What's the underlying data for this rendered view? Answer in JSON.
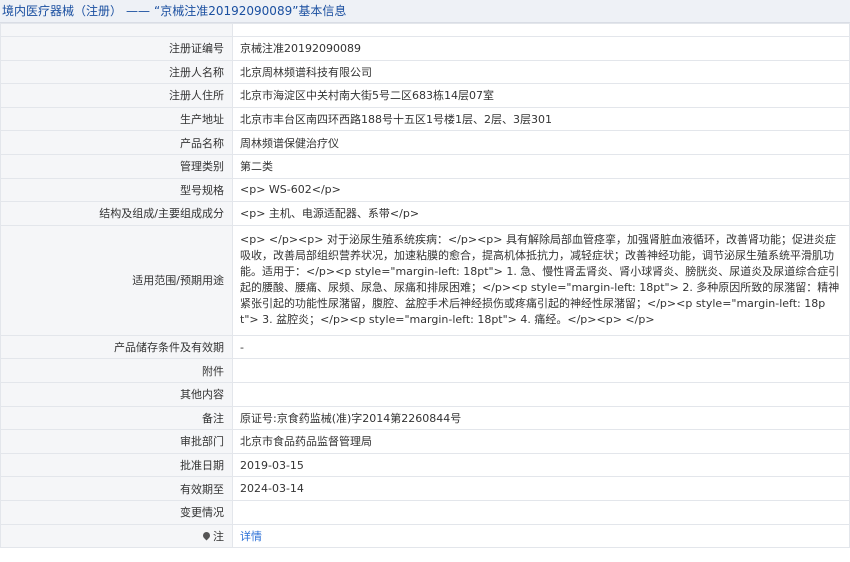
{
  "header": {
    "category": "境内医疗器械（注册）",
    "separator": "——",
    "title": "“京械注准20192090089”基本信息"
  },
  "rows": [
    {
      "label": "注册证编号",
      "value": "京械注准20192090089"
    },
    {
      "label": "注册人名称",
      "value": "北京周林频谱科技有限公司"
    },
    {
      "label": "注册人住所",
      "value": "北京市海淀区中关村南大街5号二区683栋14层07室"
    },
    {
      "label": "生产地址",
      "value": "北京市丰台区南四环西路188号十五区1号楼1层、2层、3层301"
    },
    {
      "label": "产品名称",
      "value": "周林频谱保健治疗仪"
    },
    {
      "label": "管理类别",
      "value": "第二类"
    },
    {
      "label": "型号规格",
      "value": "<p> WS-602</p>"
    },
    {
      "label": "结构及组成/主要组成成分",
      "value": "<p> 主机、电源适配器、系带</p>"
    },
    {
      "label": "适用范围/预期用途",
      "value": "<p> </p><p> 对于泌尿生殖系统疾病：</p><p> 具有解除局部血管痉挛，加强肾脏血液循环，改善肾功能；促进炎症吸收，改善局部组织营养状况，加速粘膜的愈合，提高机体抵抗力，减轻症状；改善神经功能，调节泌尿生殖系统平滑肌功能。适用于：</p><p style=\"margin-left: 18pt\"> 1. 急、慢性肾盂肾炎、肾小球肾炎、膀胱炎、尿道炎及尿道综合症引起的腰酸、腰痛、尿频、尿急、尿痛和排尿困难；</p><p style=\"margin-left: 18pt\"> 2. 多种原因所致的尿潴留：精神紧张引起的功能性尿潴留，腹腔、盆腔手术后神经损伤或疼痛引起的神经性尿潴留；</p><p style=\"margin-left: 18pt\"> 3. 盆腔炎；</p><p style=\"margin-left: 18pt\"> 4. 痛经。</p><p> </p>"
    },
    {
      "label": "产品储存条件及有效期",
      "value": "-"
    },
    {
      "label": "附件",
      "value": ""
    },
    {
      "label": "其他内容",
      "value": ""
    },
    {
      "label": "备注",
      "value": "原证号:京食药监械(准)字2014第2260844号"
    },
    {
      "label": "审批部门",
      "value": "北京市食品药品监督管理局"
    },
    {
      "label": "批准日期",
      "value": "2019-03-15"
    },
    {
      "label": "有效期至",
      "value": "2024-03-14"
    },
    {
      "label": "变更情况",
      "value": ""
    }
  ],
  "footer_row": {
    "label": "注",
    "link_text": "详情",
    "icon": "pin-icon"
  }
}
